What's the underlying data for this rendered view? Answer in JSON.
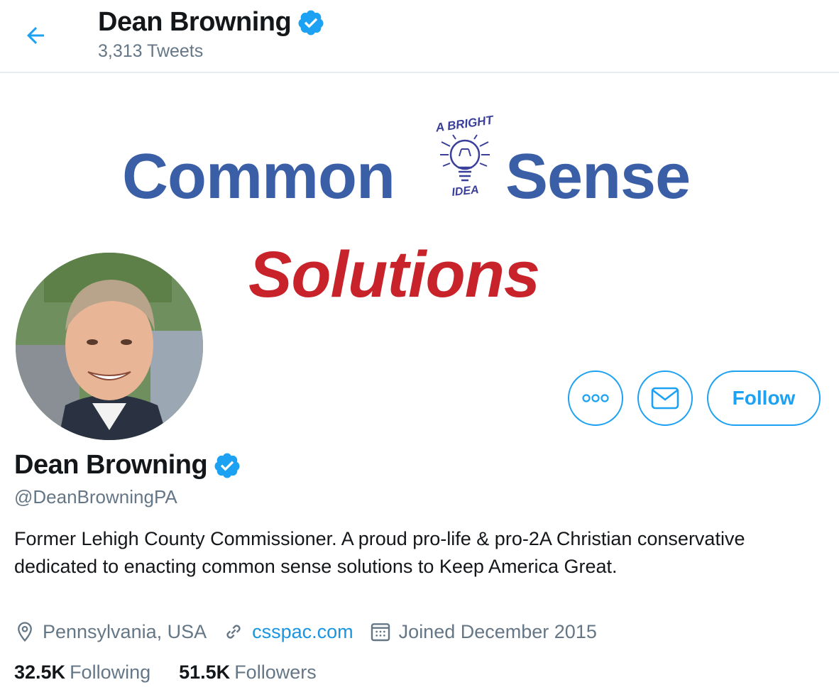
{
  "header": {
    "name": "Dean Browning",
    "tweet_count": "3,313 Tweets"
  },
  "banner": {
    "word_left": "Common",
    "word_right": "Sense",
    "bulb_top_text": "A BRIGHT",
    "bulb_bottom_text": "IDEA",
    "word_bottom": "Solutions"
  },
  "actions": {
    "follow_label": "Follow"
  },
  "profile": {
    "name": "Dean Browning",
    "handle": "@DeanBrowningPA",
    "bio": "Former Lehigh County Commissioner. A proud pro-life & pro-2A Christian conservative dedicated to enacting common sense solutions to Keep America Great.",
    "location": "Pennsylvania, USA",
    "website": "csspac.com",
    "joined": "Joined December 2015"
  },
  "stats": {
    "following_count": "32.5K",
    "following_label": "Following",
    "followers_count": "51.5K",
    "followers_label": "Followers"
  },
  "colors": {
    "accent": "#1da1f2",
    "banner_blue": "#3a5fa6",
    "banner_red": "#c8232a",
    "muted_text": "#657786"
  }
}
